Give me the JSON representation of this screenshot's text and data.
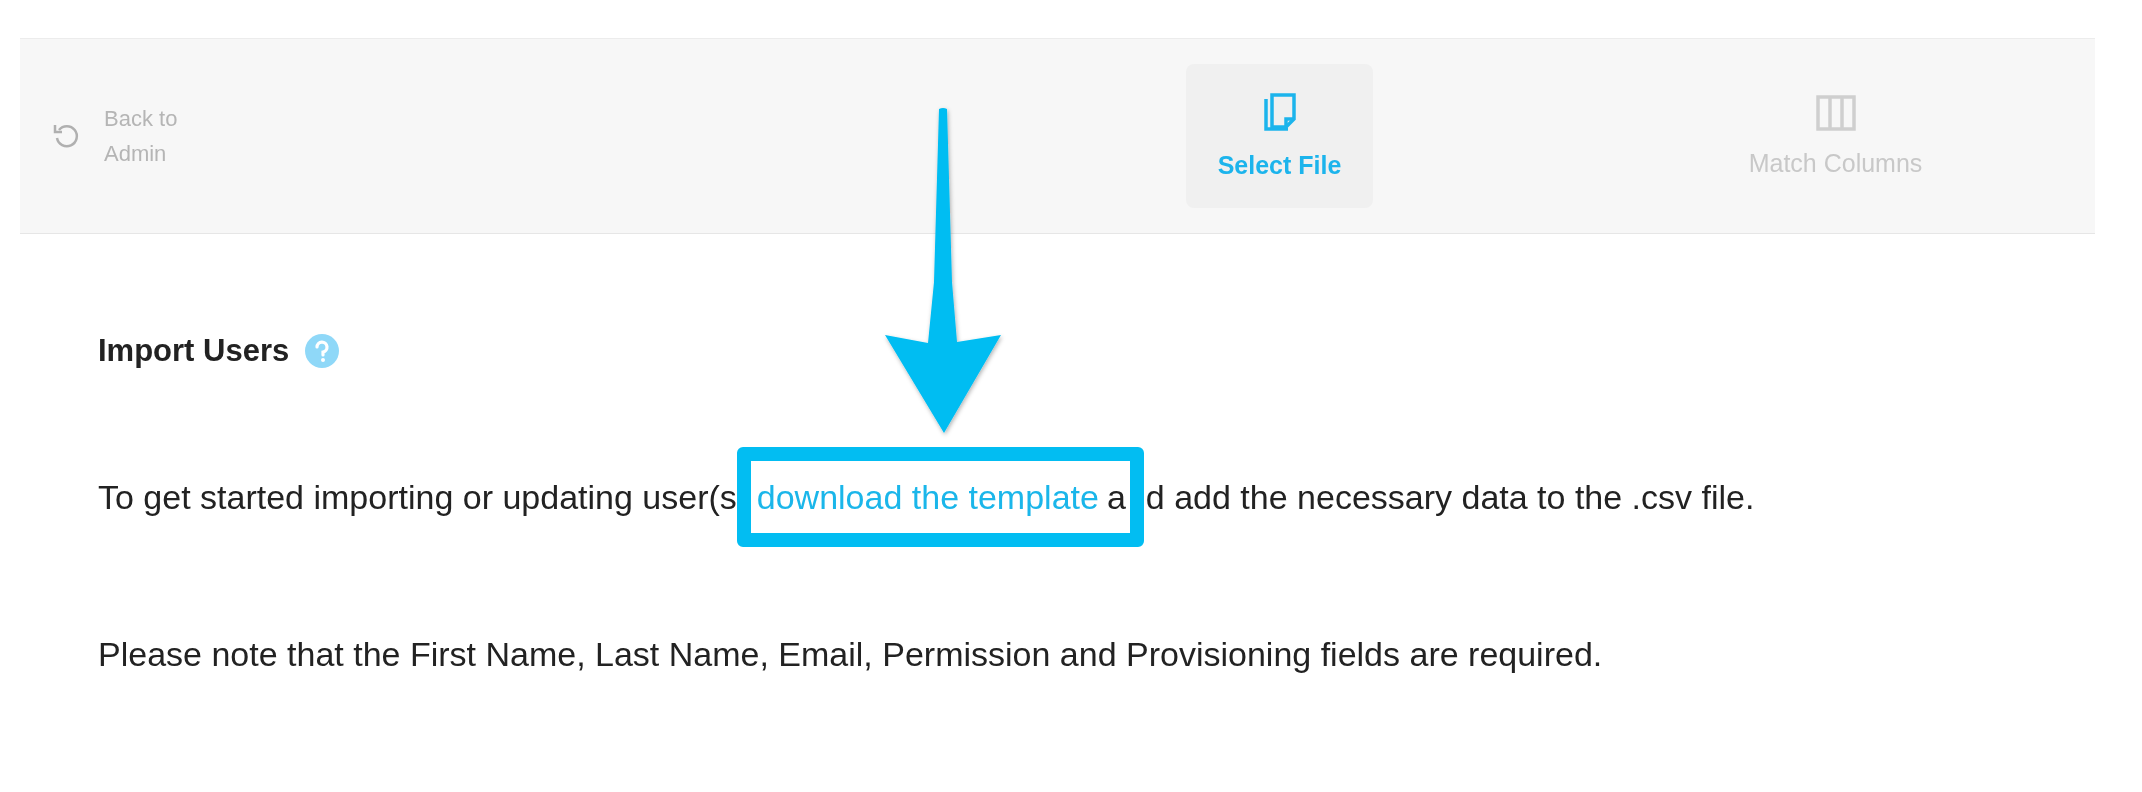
{
  "header": {
    "back_label": "Back to Admin",
    "steps": [
      {
        "label": "Select File",
        "kind": "file",
        "selected": true
      },
      {
        "label": "Match Columns",
        "kind": "columns",
        "selected": false
      }
    ]
  },
  "section": {
    "title": "Import Users",
    "intro_before": "To get started importing or updating user(s",
    "intro_link": "download the template",
    "intro_covered": "a",
    "intro_after": "d add the necessary data to the .csv file.",
    "note": "Please note that the First Name, Last Name, Email, Permission and Provisioning fields are required."
  }
}
